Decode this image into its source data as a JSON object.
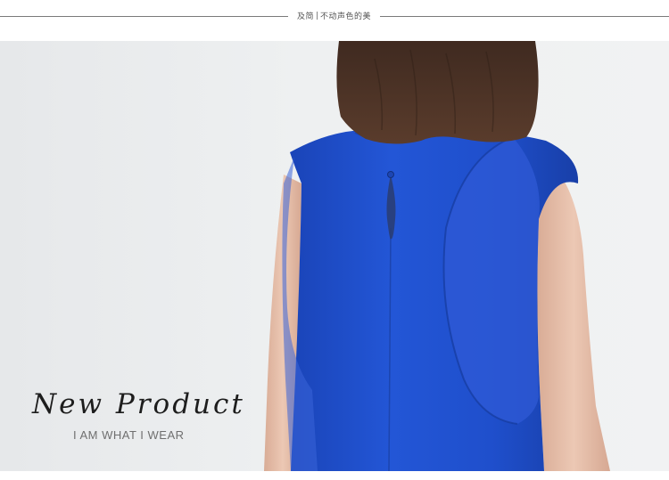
{
  "header": {
    "brand_name": "及简",
    "brand_slogan": "不动声色的美"
  },
  "hero": {
    "headline": "New Product",
    "tagline": "I AM WHAT I WEAR"
  },
  "colors": {
    "garment_blue": "#1e4fd0",
    "background_gray": "#eceef0",
    "hair_brown": "#4a3428",
    "skin": "#e8c2ae"
  }
}
